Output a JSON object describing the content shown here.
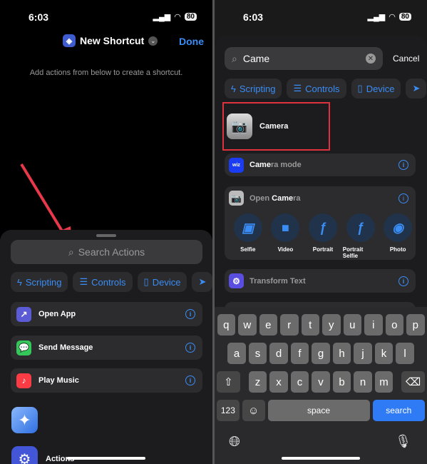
{
  "left": {
    "time": "6:03",
    "battery": "80",
    "title": "New Shortcut",
    "done": "Done",
    "hint": "Add actions from below to create a shortcut.",
    "search_placeholder": "Search Actions",
    "chips": [
      "Scripting",
      "Controls",
      "Device"
    ],
    "rows": [
      {
        "label": "Open App",
        "color": "#5b5bd6"
      },
      {
        "label": "Send Message",
        "color": "#34c759"
      },
      {
        "label": "Play Music",
        "color": "#fc3c44"
      }
    ],
    "bottom_label": "Actions"
  },
  "right": {
    "time": "6:03",
    "battery": "80",
    "search_value": "Came",
    "cancel": "Cancel",
    "chips": [
      "Scripting",
      "Controls",
      "Device"
    ],
    "top_result": "Camera",
    "camera_mode": {
      "match": "Came",
      "rest": "ra mode"
    },
    "open_camera": {
      "prefix": "Open ",
      "match": "Came",
      "rest": "ra"
    },
    "options": [
      "Selfie",
      "Video",
      "Portrait",
      "Portrait Selfie",
      "Photo"
    ],
    "transform": "Transform Text",
    "keyboard": {
      "row1": [
        "q",
        "w",
        "e",
        "r",
        "t",
        "y",
        "u",
        "i",
        "o",
        "p"
      ],
      "row2": [
        "a",
        "s",
        "d",
        "f",
        "g",
        "h",
        "j",
        "k",
        "l"
      ],
      "row3": [
        "z",
        "x",
        "c",
        "v",
        "b",
        "n",
        "m"
      ],
      "numbers": "123",
      "space": "space",
      "search": "search"
    },
    "highlight_color": "#e0323c",
    "accent": "#3a8df5"
  }
}
